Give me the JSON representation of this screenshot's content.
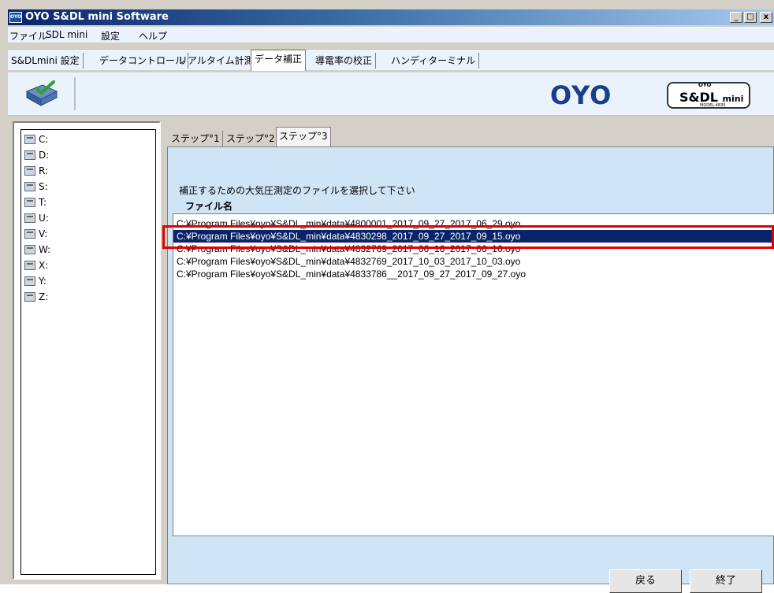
{
  "window": {
    "title": "OYO S&DL mini Software",
    "icon_label": "OYO",
    "minimize": "_",
    "maximize": "□",
    "close": "x"
  },
  "menu": [
    "ファイル",
    "SDL mini",
    "設定",
    "ヘルプ"
  ],
  "main_tabs": [
    {
      "label": "S&DLmini 設定",
      "active": false
    },
    {
      "label": "データコントロール",
      "active": false
    },
    {
      "label": "リアルタイム計測",
      "active": false
    },
    {
      "label": "データ補正",
      "active": true
    },
    {
      "label": "導電率の校正",
      "active": false
    },
    {
      "label": "ハンディターミナル",
      "active": false
    }
  ],
  "logos": {
    "oyo": "OYO",
    "sdl_top": "OYO",
    "sdl_main": "S&DL",
    "sdl_mini": "mini",
    "sdl_sub": "MODEL-4830"
  },
  "drives": [
    "C:",
    "D:",
    "R:",
    "S:",
    "T:",
    "U:",
    "V:",
    "W:",
    "X:",
    "Y:",
    "Z:"
  ],
  "step_tabs": [
    {
      "label": "ステップ°1",
      "active": false
    },
    {
      "label": "ステップ°2",
      "active": false
    },
    {
      "label": "ステップ°3",
      "active": true
    }
  ],
  "instruction": "補正するための大気圧測定のファイルを選択して下さい",
  "file_list": {
    "header": "ファイル名",
    "selected_index": 1,
    "files": [
      "C:¥Program Files¥oyo¥S&DL_min¥data¥4800001_2017_09_27_2017_06_29.oyo",
      "C:¥Program Files¥oyo¥S&DL_min¥data¥4830298_2017_09_27_2017_09_15.oyo",
      "C:¥Program Files¥oyo¥S&DL_min¥data¥4832769_2017_06_16_2017_06_16.oyo",
      "C:¥Program Files¥oyo¥S&DL_min¥data¥4832769_2017_10_03_2017_10_03.oyo",
      "C:¥Program Files¥oyo¥S&DL_min¥data¥4833786__2017_09_27_2017_09_27.oyo"
    ]
  },
  "buttons": {
    "back": "戻る",
    "finish": "終了"
  },
  "colors": {
    "selection": "#0a246a",
    "highlight_box": "#e00000",
    "oyo_blue": "#1b3e8a"
  }
}
